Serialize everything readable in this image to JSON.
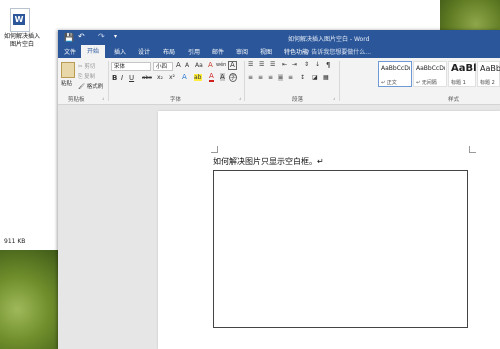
{
  "desktop": {
    "file_label": "如何解决插入图片空白",
    "file_size": "911 KB"
  },
  "window": {
    "title": "如何解决插入图片空白 - Word",
    "qat": {
      "save_glyph": "💾",
      "undo_glyph": "↶",
      "redo_glyph": "↷",
      "more_glyph": "▾"
    }
  },
  "tabs": [
    "文件",
    "开始",
    "插入",
    "设计",
    "布局",
    "引用",
    "邮件",
    "审阅",
    "视图",
    "特色功能"
  ],
  "tell_me": "♀ 告诉我您想要做什么...",
  "ribbon": {
    "clipboard": {
      "paste": "粘贴",
      "cut": "✂ 剪切",
      "copy": "⎘ 复制",
      "format_painter": "🖌 格式刷",
      "group_label": "剪贴板"
    },
    "font": {
      "font_name": "宋体",
      "font_size": "小四",
      "grow": "A",
      "shrink": "A",
      "case": "Aa",
      "clear": "A",
      "phonetic": "wén",
      "border_char": "A",
      "bold": "B",
      "italic": "I",
      "underline": "U",
      "strike": "abc",
      "subscript": "x₂",
      "superscript": "x²",
      "effects": "A",
      "highlight": "ab",
      "color": "A",
      "shade": "A",
      "circle": "字",
      "group_label": "字体"
    },
    "paragraph": {
      "group_label": "段落"
    },
    "styles": {
      "items": [
        {
          "sample": "AaBbCcDı",
          "name": "↵ 正文"
        },
        {
          "sample": "AaBbCcDı",
          "name": "↵ 无间隔"
        },
        {
          "sample": "AaBl",
          "name": "标题 1"
        },
        {
          "sample": "AaBb",
          "name": "标题 2"
        }
      ],
      "group_label": "样式"
    }
  },
  "document": {
    "text": "如何解决图片只显示空白框。↵"
  }
}
